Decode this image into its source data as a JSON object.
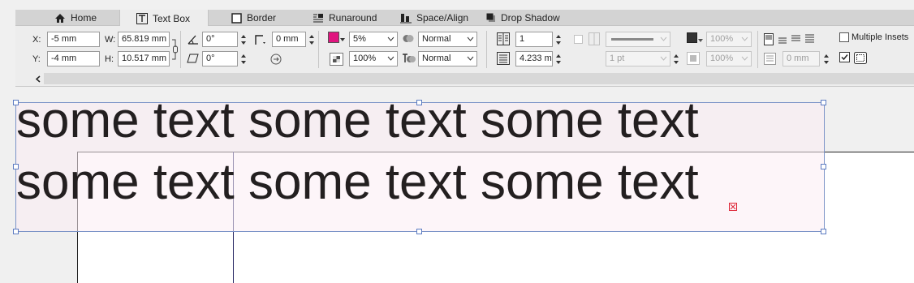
{
  "tabs": [
    {
      "label": "Home",
      "icon": "home-icon",
      "active": false
    },
    {
      "label": "Text Box",
      "icon": "text-box-icon",
      "active": true
    },
    {
      "label": "Border",
      "icon": "border-icon",
      "active": false
    },
    {
      "label": "Runaround",
      "icon": "runaround-icon",
      "active": false
    },
    {
      "label": "Space/Align",
      "icon": "space-align-icon",
      "active": false
    },
    {
      "label": "Drop Shadow",
      "icon": "drop-shadow-icon",
      "active": false
    }
  ],
  "geometry": {
    "x_label": "X:",
    "x_value": "-5 mm",
    "y_label": "Y:",
    "y_value": "-4 mm",
    "w_label": "W:",
    "w_value": "65.819 mm",
    "h_label": "H:",
    "h_value": "10.517 mm",
    "angle_value": "0°",
    "skew_value": "0°",
    "corner_value": "0 mm"
  },
  "color": {
    "fill_swatch": "#e0157f",
    "shade_value": "5%",
    "blend_mode_1": "Normal",
    "opacity_value": "100%",
    "blend_mode_2": "Normal"
  },
  "columns": {
    "columns_value": "1",
    "gutter_value": "4.233 m"
  },
  "frame_border": {
    "width_value": "1 pt",
    "opacity_1": "100%",
    "opacity_2": "100%"
  },
  "insets": {
    "inset_value": "0 mm",
    "multiple_insets_label": "Multiple Insets"
  },
  "document": {
    "line1": "some text some text some text",
    "line2": "some text some text some text"
  },
  "colors": {
    "accent_handle": "#5c7bc2",
    "overset_red": "#d22233",
    "text_color": "#231f20"
  }
}
